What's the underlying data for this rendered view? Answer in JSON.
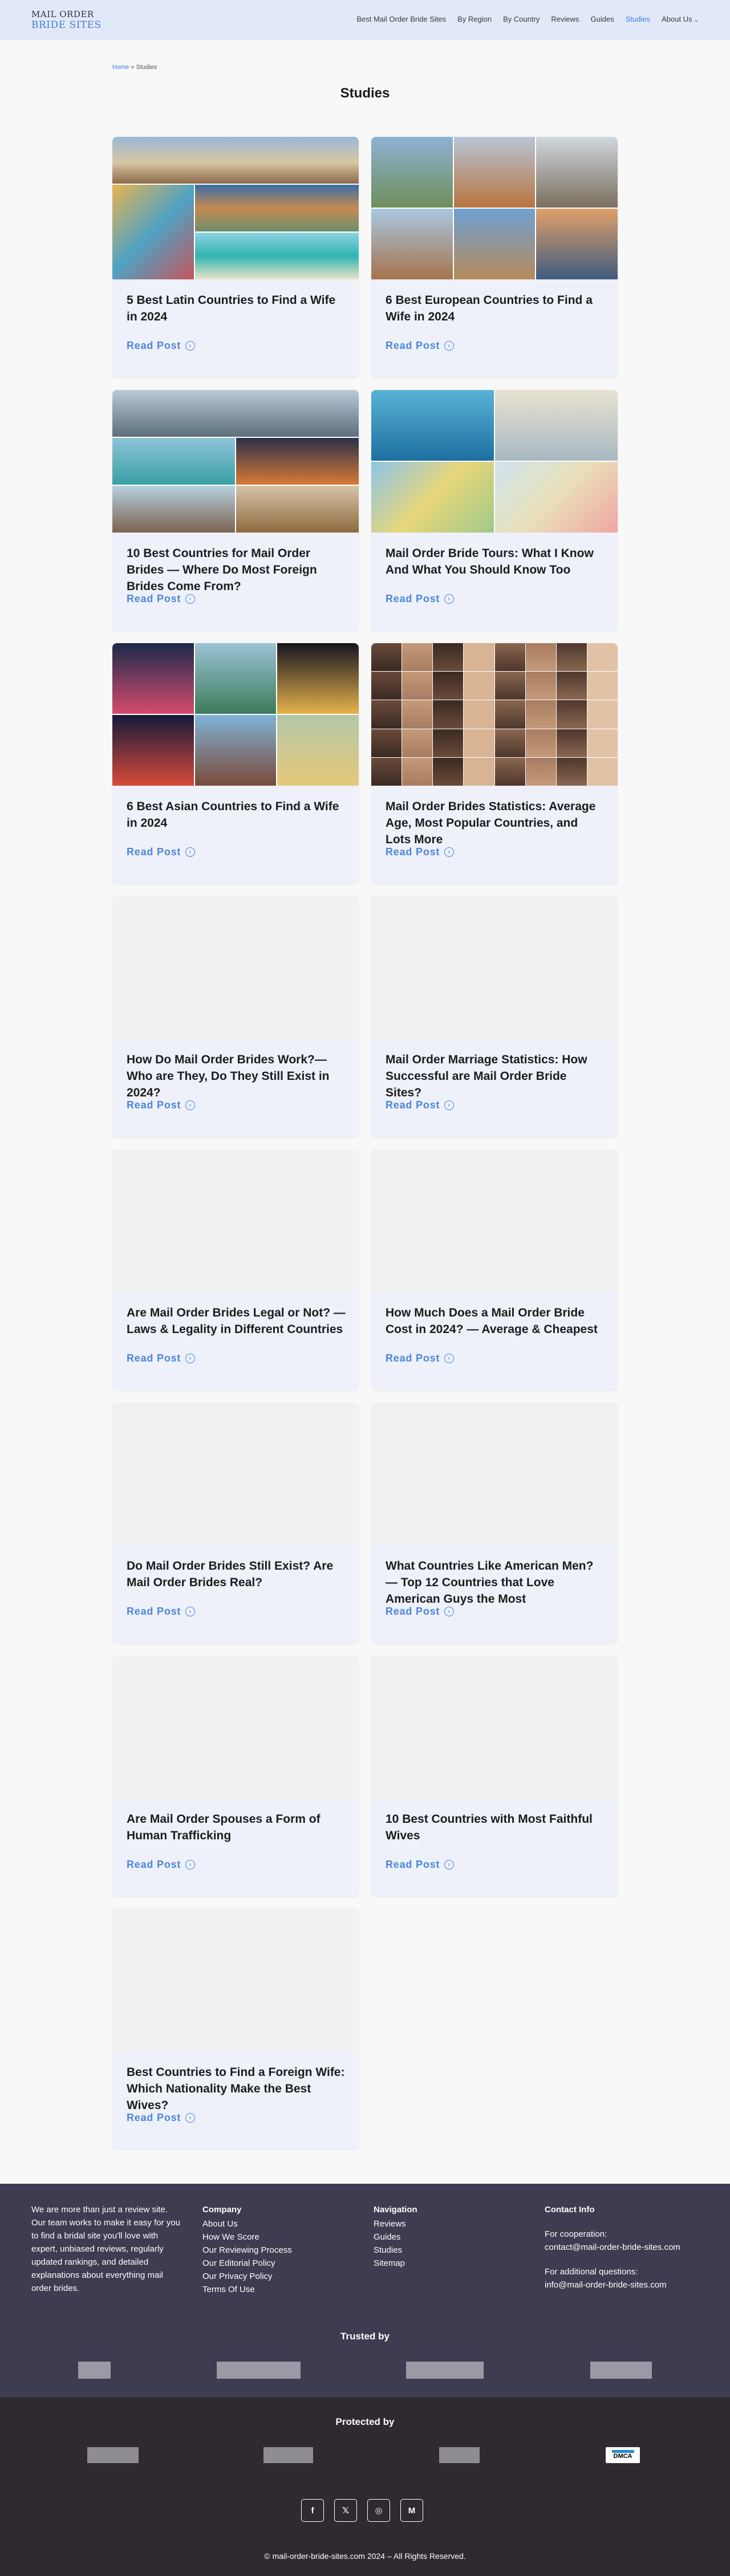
{
  "header": {
    "logo_line1": "MAIL ORDER",
    "logo_line2": "BRIDE SITES",
    "nav": [
      {
        "label": "Best Mail Order Bride Sites"
      },
      {
        "label": "By Region"
      },
      {
        "label": "By Country"
      },
      {
        "label": "Reviews"
      },
      {
        "label": "Guides"
      },
      {
        "label": "Studies"
      },
      {
        "label": "About Us"
      }
    ]
  },
  "breadcrumb": {
    "home": "Home",
    "separator": "»",
    "current": "Studies"
  },
  "page_title": "Studies",
  "read_more_label": "Read Post",
  "cards": [
    {
      "title": "5 Best Latin Countries to Find a Wife in 2024",
      "image": "collage-latin-cities"
    },
    {
      "title": "6 Best European Countries to Find a Wife in 2024",
      "image": "collage-european-cities"
    },
    {
      "title": "10 Best Countries for Mail Order Brides — Where Do Most Foreign Brides Come From?",
      "image": "collage-world-cities"
    },
    {
      "title": "Mail Order Bride Tours: What I Know And What You Should Know Too",
      "image": "collage-travel-maps"
    },
    {
      "title": "6 Best Asian Countries to Find a Wife in 2024",
      "image": "collage-asian-cities"
    },
    {
      "title": "Mail Order Brides Statistics: Average Age, Most Popular Countries, and Lots More",
      "image": "collage-women-portraits"
    },
    {
      "title": "How Do Mail Order Brides Work?— Who are They, Do They Still Exist in 2024?",
      "image": "placeholder"
    },
    {
      "title": "Mail Order Marriage Statistics: How Successful are Mail Order Bride Sites?",
      "image": "placeholder"
    },
    {
      "title": "Are Mail Order Brides Legal or Not? — Laws & Legality in Different Countries",
      "image": "placeholder"
    },
    {
      "title": "How Much Does a Mail Order Bride Cost in 2024? — Average & Cheapest",
      "image": "placeholder"
    },
    {
      "title": "Do Mail Order Brides Still Exist? Are Mail Order Brides Real?",
      "image": "placeholder"
    },
    {
      "title": "What Countries Like American Men? — Top 12 Countries that Love American Guys the Most",
      "image": "placeholder"
    },
    {
      "title": "Are Mail Order Spouses a Form of Human Trafficking",
      "image": "placeholder"
    },
    {
      "title": "10 Best Countries with Most Faithful Wives",
      "image": "placeholder"
    },
    {
      "title": "Best Countries to Find a Foreign Wife: Which Nationality Make the Best Wives?",
      "image": "placeholder"
    }
  ],
  "footer": {
    "about": "We are more than just a review site. Our team works to make it easy for you to find a bridal site you'll love with expert, unbiased reviews, regularly updated rankings, and detailed explanations about everything mail order brides.",
    "company": {
      "heading": "Company",
      "links": [
        "About Us",
        "How We Score",
        "Our Reviewing Process",
        "Our Editorial Policy",
        "Our Privacy Policy",
        "Terms Of Use"
      ]
    },
    "navigation": {
      "heading": "Navigation",
      "links": [
        "Reviews",
        "Guides",
        "Studies",
        "Sitemap"
      ]
    },
    "contact": {
      "heading": "Contact Info",
      "cooperation_label": "For cooperation:",
      "cooperation_email": "contact@mail-order-bride-sites.com",
      "questions_label": "For additional questions:",
      "questions_email": "info@mail-order-bride-sites.com"
    },
    "trusted_by": "Trusted by",
    "protected_by": "Protected by",
    "dmca": "DMCA",
    "socials": [
      {
        "icon": "facebook-icon",
        "glyph": "f"
      },
      {
        "icon": "x-icon",
        "glyph": "𝕏"
      },
      {
        "icon": "instagram-icon",
        "glyph": "◎"
      },
      {
        "icon": "medium-icon",
        "glyph": "M"
      }
    ],
    "copyright": "© mail-order-bride-sites.com 2024 – All Rights Reserved."
  },
  "colors": {
    "header_bg": "#e1e9f8",
    "accent": "#3f7be0",
    "card_bg": "#eef1fa",
    "footer_top": "#3d3c50",
    "footer_bottom": "#2f2930"
  }
}
